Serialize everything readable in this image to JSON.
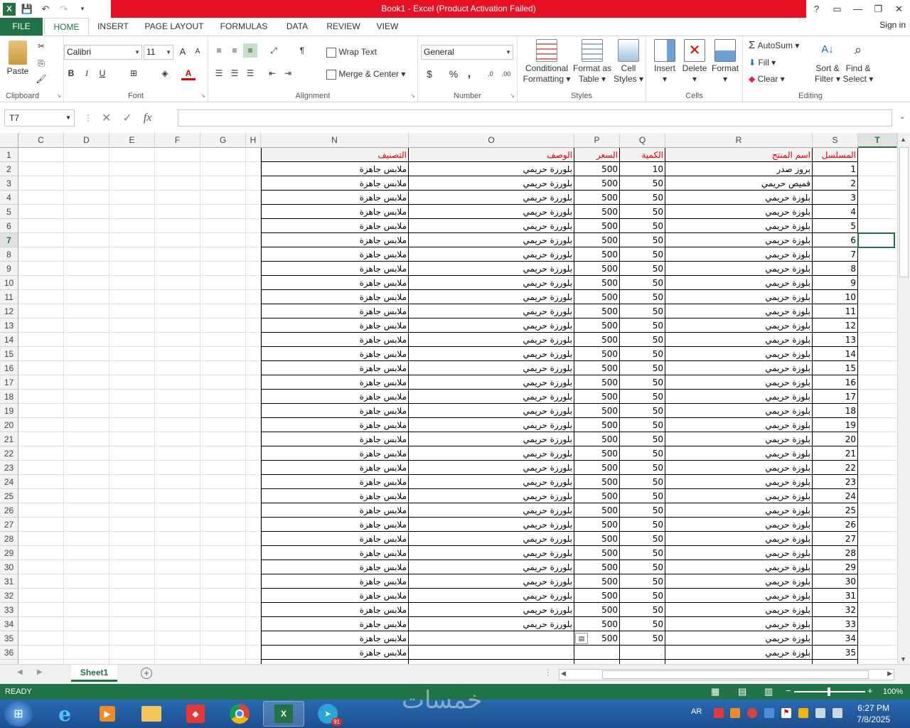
{
  "window": {
    "title": "Book1 -  Excel (Product Activation Failed)",
    "help": "?",
    "controls": [
      "?",
      "▭",
      "—",
      "❐",
      "✕"
    ]
  },
  "quick_access": {
    "save": "save-icon",
    "undo": "undo-icon",
    "redo": "redo-icon"
  },
  "ribbon_tabs": [
    "FILE",
    "HOME",
    "INSERT",
    "PAGE LAYOUT",
    "FORMULAS",
    "DATA",
    "REVIEW",
    "VIEW"
  ],
  "sign_in": "Sign in",
  "ribbon": {
    "clipboard": {
      "label": "Clipboard",
      "paste": "Paste"
    },
    "font": {
      "label": "Font",
      "name": "Calibri",
      "size": "11",
      "grow": "A",
      "shrink": "A",
      "bold": "B",
      "italic": "I",
      "underline": "U"
    },
    "alignment": {
      "label": "Alignment",
      "wrap": "Wrap Text",
      "merge": "Merge & Center"
    },
    "number": {
      "label": "Number",
      "format": "General",
      "currency": "$",
      "percent": "%",
      "comma": ","
    },
    "styles": {
      "label": "Styles",
      "conditional": [
        "Conditional",
        "Formatting"
      ],
      "format_table": [
        "Format as",
        "Table"
      ],
      "cell_styles": [
        "Cell",
        "Styles"
      ]
    },
    "cells": {
      "label": "Cells",
      "insert": "Insert",
      "delete": "Delete",
      "format": "Format"
    },
    "editing": {
      "label": "Editing",
      "autosum": "AutoSum",
      "fill": "Fill",
      "clear": "Clear",
      "sort": [
        "Sort &",
        "Filter"
      ],
      "find": [
        "Find &",
        "Select"
      ]
    }
  },
  "formula_bar": {
    "name_box": "T7",
    "fx": "fx",
    "value": ""
  },
  "columns": [
    "C",
    "D",
    "E",
    "F",
    "G",
    "H",
    "N",
    "O",
    "P",
    "Q",
    "R",
    "S",
    "T"
  ],
  "selected_cell": {
    "column": "T",
    "row": 7
  },
  "header_row": [
    "التصنيف",
    "الوصف",
    "السعر",
    "الكمية",
    "اسم المنتج",
    "المسلسل"
  ],
  "rows": [
    [
      "ملابس جاهزة",
      "بلورزة حريمي",
      "500",
      "10",
      "بروز صدر",
      "1"
    ],
    [
      "ملابس جاهزة",
      "بلورزة حريمي",
      "500",
      "50",
      "قميص حريمي",
      "2"
    ],
    [
      "ملابس جاهزة",
      "بلورزة حريمي",
      "500",
      "50",
      "بلوزة حريمي",
      "3"
    ],
    [
      "ملابس جاهزة",
      "بلورزة حريمي",
      "500",
      "50",
      "بلوزة حريمي",
      "4"
    ],
    [
      "ملابس جاهزة",
      "بلورزة حريمي",
      "500",
      "50",
      "بلوزة حريمي",
      "5"
    ],
    [
      "ملابس جاهزة",
      "بلورزة حريمي",
      "500",
      "50",
      "بلوزة حريمي",
      "6"
    ],
    [
      "ملابس جاهزة",
      "بلورزة حريمي",
      "500",
      "50",
      "بلوزة حريمي",
      "7"
    ],
    [
      "ملابس جاهزة",
      "بلورزة حريمي",
      "500",
      "50",
      "بلوزة حريمي",
      "8"
    ],
    [
      "ملابس جاهزة",
      "بلورزة حريمي",
      "500",
      "50",
      "بلوزة حريمي",
      "9"
    ],
    [
      "ملابس جاهزة",
      "بلورزة حريمي",
      "500",
      "50",
      "بلوزة حريمي",
      "10"
    ],
    [
      "ملابس جاهزة",
      "بلورزة حريمي",
      "500",
      "50",
      "بلوزة حريمي",
      "11"
    ],
    [
      "ملابس جاهزة",
      "بلورزة حريمي",
      "500",
      "50",
      "بلوزة حريمي",
      "12"
    ],
    [
      "ملابس جاهزة",
      "بلورزة حريمي",
      "500",
      "50",
      "بلوزة حريمي",
      "13"
    ],
    [
      "ملابس جاهزة",
      "بلورزة حريمي",
      "500",
      "50",
      "بلوزة حريمي",
      "14"
    ],
    [
      "ملابس جاهزة",
      "بلورزة حريمي",
      "500",
      "50",
      "بلوزة حريمي",
      "15"
    ],
    [
      "ملابس جاهزة",
      "بلورزة حريمي",
      "500",
      "50",
      "بلوزة حريمي",
      "16"
    ],
    [
      "ملابس جاهزة",
      "بلورزة حريمي",
      "500",
      "50",
      "بلوزة حريمي",
      "17"
    ],
    [
      "ملابس جاهزة",
      "بلورزة حريمي",
      "500",
      "50",
      "بلوزة حريمي",
      "18"
    ],
    [
      "ملابس جاهزة",
      "بلورزة حريمي",
      "500",
      "50",
      "بلوزة حريمي",
      "19"
    ],
    [
      "ملابس جاهزة",
      "بلورزة حريمي",
      "500",
      "50",
      "بلوزة حريمي",
      "20"
    ],
    [
      "ملابس جاهزة",
      "بلورزة حريمي",
      "500",
      "50",
      "بلوزة حريمي",
      "21"
    ],
    [
      "ملابس جاهزة",
      "بلورزة حريمي",
      "500",
      "50",
      "بلوزة حريمي",
      "22"
    ],
    [
      "ملابس جاهزة",
      "بلورزة حريمي",
      "500",
      "50",
      "بلوزة حريمي",
      "23"
    ],
    [
      "ملابس جاهزة",
      "بلورزة حريمي",
      "500",
      "50",
      "بلوزة حريمي",
      "24"
    ],
    [
      "ملابس جاهزة",
      "بلورزة حريمي",
      "500",
      "50",
      "بلوزة حريمي",
      "25"
    ],
    [
      "ملابس جاهزة",
      "بلورزة حريمي",
      "500",
      "50",
      "بلوزة حريمي",
      "26"
    ],
    [
      "ملابس جاهزة",
      "بلورزة حريمي",
      "500",
      "50",
      "بلوزة حريمي",
      "27"
    ],
    [
      "ملابس جاهزة",
      "بلورزة حريمي",
      "500",
      "50",
      "بلوزة حريمي",
      "28"
    ],
    [
      "ملابس جاهزة",
      "بلورزة حريمي",
      "500",
      "50",
      "بلوزة حريمي",
      "29"
    ],
    [
      "ملابس جاهزة",
      "بلورزة حريمي",
      "500",
      "50",
      "بلوزة حريمي",
      "30"
    ],
    [
      "ملابس جاهزة",
      "بلورزة حريمي",
      "500",
      "50",
      "بلوزة حريمي",
      "31"
    ],
    [
      "ملابس جاهزة",
      "بلورزة حريمي",
      "500",
      "50",
      "بلوزة حريمي",
      "32"
    ],
    [
      "ملابس جاهزة",
      "بلورزة حريمي",
      "500",
      "50",
      "بلوزة حريمي",
      "33"
    ],
    [
      "ملابس جاهزة",
      "",
      "500",
      "50",
      "بلوزة حريمي",
      "34"
    ],
    [
      "ملابس جاهزة",
      "",
      "",
      "",
      "بلوزة حريمي",
      "35"
    ]
  ],
  "sheet_tabs": [
    "Sheet1"
  ],
  "status": {
    "mode": "READY",
    "zoom": "100%"
  },
  "taskbar": {
    "lang": "AR",
    "time": "6:27 PM",
    "date": "7/8/2025",
    "telegram_badge": "91"
  },
  "watermark": "خمسات",
  "colors": {
    "excel_green": "#217346",
    "title_red": "#e81123",
    "header_text": "#e00000"
  }
}
